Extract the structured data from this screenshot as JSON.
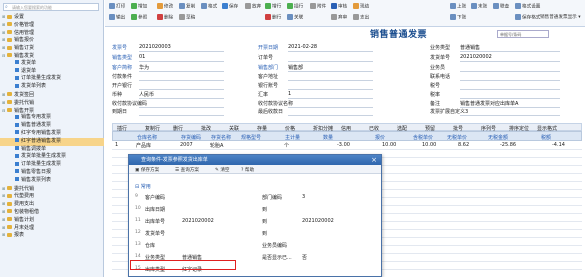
{
  "sidebar": {
    "search_placeholder": "请输入您要搜索的功能",
    "items": [
      {
        "label": "设置",
        "type": "grp",
        "indent": 1,
        "tog": "+"
      },
      {
        "label": "价格管理",
        "type": "grp",
        "indent": 1,
        "tog": "+"
      },
      {
        "label": "信用管理",
        "type": "grp",
        "indent": 1,
        "tog": "+"
      },
      {
        "label": "销售报价",
        "type": "grp",
        "indent": 1,
        "tog": "+"
      },
      {
        "label": "销售订货",
        "type": "grp",
        "indent": 1,
        "tog": "+"
      },
      {
        "label": "销售发货",
        "type": "grp",
        "indent": 1,
        "tog": "-"
      },
      {
        "label": "发货单",
        "type": "leaf",
        "indent": 2,
        "tog": ""
      },
      {
        "label": "退货单",
        "type": "leaf",
        "indent": 2,
        "tog": ""
      },
      {
        "label": "订单批量生成发货",
        "type": "leaf",
        "indent": 2,
        "tog": ""
      },
      {
        "label": "发货单列表",
        "type": "leaf",
        "indent": 2,
        "tog": ""
      },
      {
        "label": "发货签回",
        "type": "grp",
        "indent": 1,
        "tog": "+"
      },
      {
        "label": "委托代销",
        "type": "grp",
        "indent": 1,
        "tog": "+"
      },
      {
        "label": "销售开票",
        "type": "grp",
        "indent": 1,
        "tog": "-"
      },
      {
        "label": "销售专用发票",
        "type": "leaf",
        "indent": 2,
        "tog": ""
      },
      {
        "label": "销售普通发票",
        "type": "leaf",
        "indent": 2,
        "tog": ""
      },
      {
        "label": "红字专用销售发票",
        "type": "leaf",
        "indent": 2,
        "tog": ""
      },
      {
        "label": "红字普通销售发票",
        "type": "leaf",
        "indent": 2,
        "tog": "",
        "selected": true
      },
      {
        "label": "销售调拨单",
        "type": "leaf",
        "indent": 2,
        "tog": ""
      },
      {
        "label": "发货单批量生成发票",
        "type": "leaf",
        "indent": 2,
        "tog": ""
      },
      {
        "label": "订单批量生成发票",
        "type": "leaf",
        "indent": 2,
        "tog": ""
      },
      {
        "label": "销售零售日报",
        "type": "leaf",
        "indent": 2,
        "tog": ""
      },
      {
        "label": "销售发票列表",
        "type": "leaf",
        "indent": 2,
        "tog": ""
      },
      {
        "label": "委托代销",
        "type": "grp",
        "indent": 1,
        "tog": "+"
      },
      {
        "label": "代垫费用",
        "type": "grp",
        "indent": 1,
        "tog": "+"
      },
      {
        "label": "费用支出",
        "type": "grp",
        "indent": 1,
        "tog": "+"
      },
      {
        "label": "包装物租借",
        "type": "grp",
        "indent": 1,
        "tog": "+"
      },
      {
        "label": "销售计划",
        "type": "grp",
        "indent": 1,
        "tog": "+"
      },
      {
        "label": "月末处理",
        "type": "grp",
        "indent": 1,
        "tog": "+"
      },
      {
        "label": "报表",
        "type": "grp",
        "indent": 1,
        "tog": "+"
      }
    ]
  },
  "toolbar": {
    "items": [
      "打印",
      "输出",
      "增加",
      "参照",
      "修改",
      "删除",
      "复制",
      "草稿",
      "格式",
      "保存",
      "放弃",
      "增行",
      "删行",
      "插行",
      "关联",
      "附件",
      "审核",
      "弃审",
      "现结",
      "支出",
      "上张",
      "下张",
      "末张",
      "联查",
      "格式设置",
      "保存格式"
    ],
    "format_label": "销售普通发票显示"
  },
  "title": "销售普通发票",
  "search2_placeholder": "单据号/条码",
  "header": {
    "fields": [
      {
        "label": "发票号",
        "value": "2021020003",
        "blue": true
      },
      {
        "label": "开票日期",
        "value": "2021-02-28",
        "blue": true
      },
      {
        "label": "业务类型",
        "value": "普通销售",
        "blue": false
      },
      {
        "label": "销售类型",
        "value": "01",
        "blue": true
      },
      {
        "label": "订单号",
        "value": "",
        "blue": false
      },
      {
        "label": "发货单号",
        "value": "2021020002",
        "blue": false
      },
      {
        "label": "客户简称",
        "value": "华为",
        "blue": true
      },
      {
        "label": "销售部门",
        "value": "销售部",
        "blue": true
      },
      {
        "label": "业务员",
        "value": "",
        "blue": false
      },
      {
        "label": "付款条件",
        "value": "",
        "blue": false
      },
      {
        "label": "客户地址",
        "value": "",
        "blue": false
      },
      {
        "label": "联系电话",
        "value": "",
        "blue": false
      },
      {
        "label": "开户银行",
        "value": "",
        "blue": false
      },
      {
        "label": "银行账号",
        "value": "",
        "blue": false
      },
      {
        "label": "税号",
        "value": "",
        "blue": false
      },
      {
        "label": "币种",
        "value": "人民币",
        "blue": false
      },
      {
        "label": "汇率",
        "value": "1",
        "blue": false
      },
      {
        "label": "税率",
        "value": "",
        "blue": false
      },
      {
        "label": "收付款协议编码",
        "value": "",
        "blue": false
      },
      {
        "label": "收付款协议名称",
        "value": "",
        "blue": false
      },
      {
        "label": "备注",
        "value": "销售普通发票对应出库单A",
        "blue": false
      },
      {
        "label": "到期日",
        "value": "",
        "blue": false
      },
      {
        "label": "最后收款日",
        "value": "",
        "blue": false
      },
      {
        "label": "发票扩展自定义3",
        "value": "",
        "blue": false
      }
    ]
  },
  "grid": {
    "toolbar_items": [
      "插行",
      "复制行",
      "删行",
      "批改",
      "关联",
      "存量",
      "价格",
      "折扣分摊",
      "信用",
      "已收",
      "选配",
      "预留",
      "批号",
      "序列号",
      "排序定位",
      "显示格式"
    ],
    "columns": [
      "仓库名称",
      "存货编码",
      "存货名称",
      "规格型号",
      "主计量",
      "数量",
      "报价",
      "含税单价",
      "无税单价",
      "无税金额",
      "税额"
    ],
    "row": {
      "num": "1",
      "warehouse": "产品库",
      "code": "2007",
      "name": "轮胎A",
      "uom": "个",
      "qty": "-3.00",
      "quote": "10.00",
      "taxprice": "10.00",
      "price": "8.62",
      "amount": "-25.86",
      "tax": "-4.14"
    }
  },
  "modal": {
    "title": "查询条件-发票参照发货出库单",
    "bar_items": [
      "保存方案",
      "查询方案",
      "清空",
      "帮助"
    ],
    "section": "常用",
    "rows": [
      {
        "num": "9",
        "label": "客户编码",
        "value": "",
        "tlabel": "部门编码",
        "tvalue": "3"
      },
      {
        "num": "10",
        "label": "出库日期",
        "value": "",
        "tlabel": "到",
        "tvalue": ""
      },
      {
        "num": "11",
        "label": "出库单号",
        "value": "2021020002",
        "tlabel": "到",
        "tvalue": "2021020002"
      },
      {
        "num": "12",
        "label": "发货单号",
        "value": "",
        "tlabel": "到",
        "tvalue": ""
      },
      {
        "num": "13",
        "label": "仓库",
        "value": "",
        "tlabel": "业务员编码",
        "tvalue": ""
      },
      {
        "num": "14",
        "label": "业务类型",
        "value": "普通销售",
        "tlabel": "是否显示已...",
        "tvalue": "否"
      },
      {
        "num": "15",
        "label": "出库类型",
        "value": "红字记录",
        "tlabel": "",
        "tvalue": ""
      }
    ]
  },
  "colors": {
    "accent": "#2a60b5",
    "title": "#1a4d8f",
    "highlight": "#e02020",
    "selected": "#f7d48a"
  }
}
